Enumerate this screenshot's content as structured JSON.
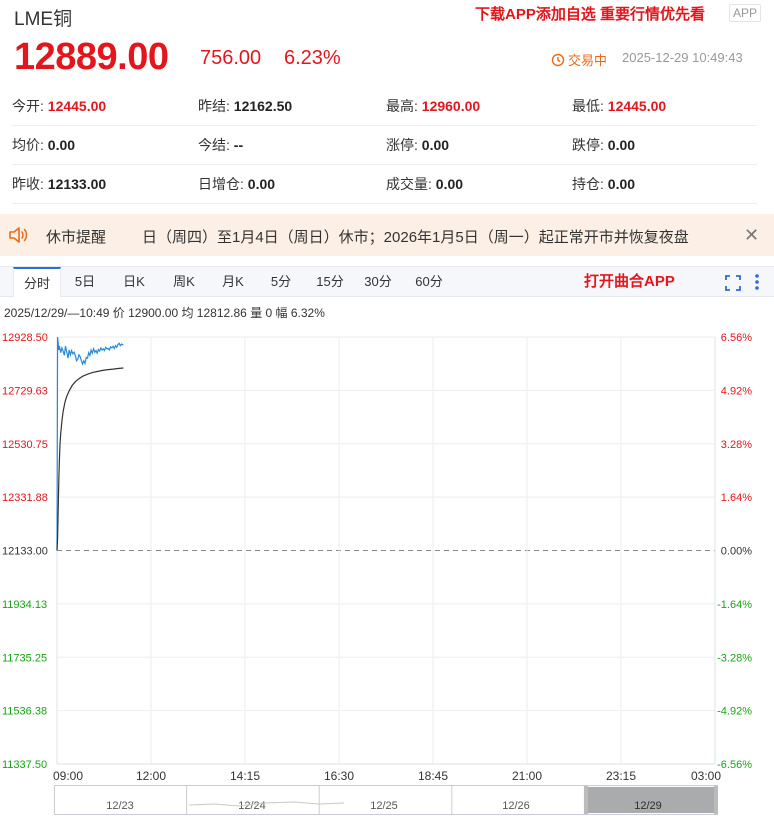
{
  "header": {
    "title": "LME铜",
    "promo": "下载APP添加自选 重要行情优先看",
    "app_badge": "APP",
    "price": "12889.00",
    "change": "756.00",
    "change_pct": "6.23%",
    "status": "交易中",
    "time": "2025-12-29 10:49:43"
  },
  "stats": [
    [
      {
        "label": "今开:",
        "value": "12445.00",
        "red": true
      },
      {
        "label": "昨结:",
        "value": "12162.50",
        "red": false
      },
      {
        "label": "最高:",
        "value": "12960.00",
        "red": true
      },
      {
        "label": "最低:",
        "value": "12445.00",
        "red": true
      }
    ],
    [
      {
        "label": "均价:",
        "value": "0.00",
        "red": false
      },
      {
        "label": "今结:",
        "value": "--",
        "red": false
      },
      {
        "label": "涨停:",
        "value": "0.00",
        "red": false
      },
      {
        "label": "跌停:",
        "value": "0.00",
        "red": false
      }
    ],
    [
      {
        "label": "昨收:",
        "value": "12133.00",
        "red": false
      },
      {
        "label": "日增仓:",
        "value": "0.00",
        "red": false
      },
      {
        "label": "成交量:",
        "value": "0.00",
        "red": false
      },
      {
        "label": "持仓:",
        "value": "0.00",
        "red": false
      }
    ]
  ],
  "notice": {
    "label": "休市提醒",
    "text": "日（周四）至1月4日（周日）休市；2026年1月5日（周一）起正常开市并恢复夜盘"
  },
  "tabs": [
    "分时",
    "5日",
    "日K",
    "周K",
    "月K",
    "5分",
    "15分",
    "30分",
    "60分"
  ],
  "open_app": "打开曲合APP",
  "info_line": "2025/12/29/—10:49  价 12900.00  均 12812.86  量 0  幅 6.32%",
  "colors": {
    "up": "#e4161d",
    "down": "#16a516",
    "price_line": "#2a8ad8",
    "avg_line": "#333333",
    "accent": "#2f6bd6"
  },
  "chart_data": {
    "type": "line",
    "base": 12133.0,
    "y_ticks_left": [
      "12928.50",
      "12729.63",
      "12530.75",
      "12331.88",
      "12133.00",
      "11934.13",
      "11735.25",
      "11536.38",
      "11337.50"
    ],
    "y_ticks_right": [
      "6.56%",
      "4.92%",
      "3.28%",
      "1.64%",
      "0.00%",
      "-1.64%",
      "-3.28%",
      "-4.92%",
      "-6.56%"
    ],
    "ylim": [
      11337.5,
      12928.5
    ],
    "x_ticks": [
      "09:00",
      "12:00",
      "14:15",
      "16:30",
      "18:45",
      "21:00",
      "23:15",
      "03:00"
    ],
    "x_minutes_total": 1080,
    "series": [
      {
        "values_minutes": [
          0,
          1,
          2,
          3,
          4,
          6,
          8,
          10,
          12,
          14,
          16,
          18,
          20,
          22,
          24,
          26,
          28,
          30,
          32,
          34,
          36,
          38,
          40,
          42,
          44,
          46,
          48,
          50,
          52,
          54,
          56,
          58,
          60,
          62,
          64,
          66,
          68,
          70,
          72,
          74,
          76,
          78,
          80,
          82,
          84,
          86,
          88,
          90,
          92,
          94,
          96,
          98,
          100,
          102,
          104,
          106,
          108,
          109
        ],
        "values": [
          12133,
          12928,
          12905,
          12880,
          12895,
          12870,
          12888,
          12876,
          12860,
          12895,
          12874,
          12850,
          12880,
          12862,
          12878,
          12866,
          12872,
          12860,
          12840,
          12845,
          12862,
          12855,
          12840,
          12828,
          12840,
          12830,
          12852,
          12850,
          12870,
          12860,
          12880,
          12868,
          12885,
          12872,
          12878,
          12868,
          12882,
          12876,
          12888,
          12880,
          12884,
          12878,
          12890,
          12884,
          12886,
          12880,
          12892,
          12888,
          12894,
          12886,
          12896,
          12890,
          12900,
          12905,
          12896,
          12902,
          12899,
          12900
        ]
      },
      {
        "values_minutes": [
          0,
          1,
          2,
          3,
          4,
          5,
          6,
          8,
          10,
          13,
          16,
          20,
          25,
          30,
          36,
          42,
          50,
          58,
          66,
          75,
          84,
          92,
          100,
          109
        ],
        "values": [
          12133,
          12180,
          12290,
          12395,
          12470,
          12530,
          12568,
          12615,
          12650,
          12685,
          12707,
          12728,
          12748,
          12762,
          12773,
          12782,
          12790,
          12796,
          12800,
          12804,
          12807,
          12809,
          12811,
          12813
        ]
      }
    ]
  },
  "date_strip": [
    "12/23",
    "12/24",
    "12/25",
    "12/26",
    "12/29"
  ]
}
